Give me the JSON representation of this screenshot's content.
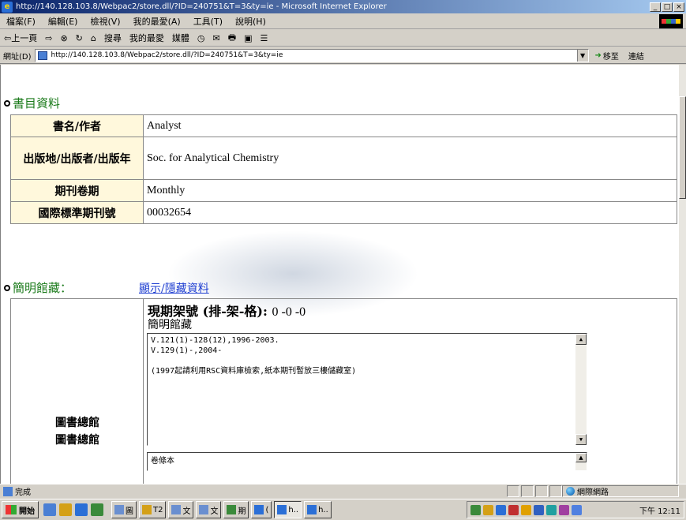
{
  "window": {
    "title": "http://140.128.103.8/Webpac2/store.dll/?ID=240751&T=3&ty=ie - Microsoft Internet Explorer",
    "controls": [
      "_",
      "□",
      "×"
    ]
  },
  "menubar": {
    "items": [
      "檔案(F)",
      "編輯(E)",
      "檢視(V)",
      "我的最愛(A)",
      "工具(T)",
      "說明(H)"
    ]
  },
  "toolbar": {
    "back": "⇦上一頁",
    "forward": "⇨",
    "stop": "⊗",
    "refresh": "↻",
    "home": "⌂",
    "search": "搜尋",
    "favorites": "我的最愛",
    "media": "媒體",
    "history": "◷",
    "mail": "✉",
    "print": "🖶",
    "edit": "▣",
    "discuss": "☰"
  },
  "addressbar": {
    "label": "網址(D)",
    "url": "http://140.128.103.8/Webpac2/store.dll/?ID=240751&T=3&ty=ie",
    "go": "移至",
    "links": "連結"
  },
  "bibliographic": {
    "title": "書目資料",
    "rows": [
      {
        "label": "書名/作者",
        "value": "Analyst"
      },
      {
        "label": "出版地/出版者/出版年",
        "value": "Soc. for Analytical Chemistry"
      },
      {
        "label": "期刊卷期",
        "value": "Monthly"
      },
      {
        "label": "國際標準期刊號",
        "value": "00032654"
      }
    ]
  },
  "holdings": {
    "title": "簡明館藏：",
    "toggle": "顯示/隱藏資料",
    "library_1": "圖書總館",
    "library_2": "圖書總館",
    "shelf_label": "現期架號 (排-架-格):",
    "shelf_value": "0 -0 -0",
    "brief_label": "簡明館藏",
    "lines": [
      "V.121(1)-128(12),1996-2003.",
      "V.129(1)-,2004-",
      "",
      "(1997起請利用RSC資料庫檢索,紙本期刊暫放三樓儲藏室)"
    ],
    "second_box": "卷條本"
  },
  "statusbar": {
    "text": "完成",
    "zone": "網際網路"
  },
  "taskbar": {
    "start": "開始",
    "buttons": [
      "圖",
      "T2",
      "文",
      "文",
      "期",
      "(",
      "h..",
      "h.."
    ],
    "clock": "下午 12:11"
  }
}
